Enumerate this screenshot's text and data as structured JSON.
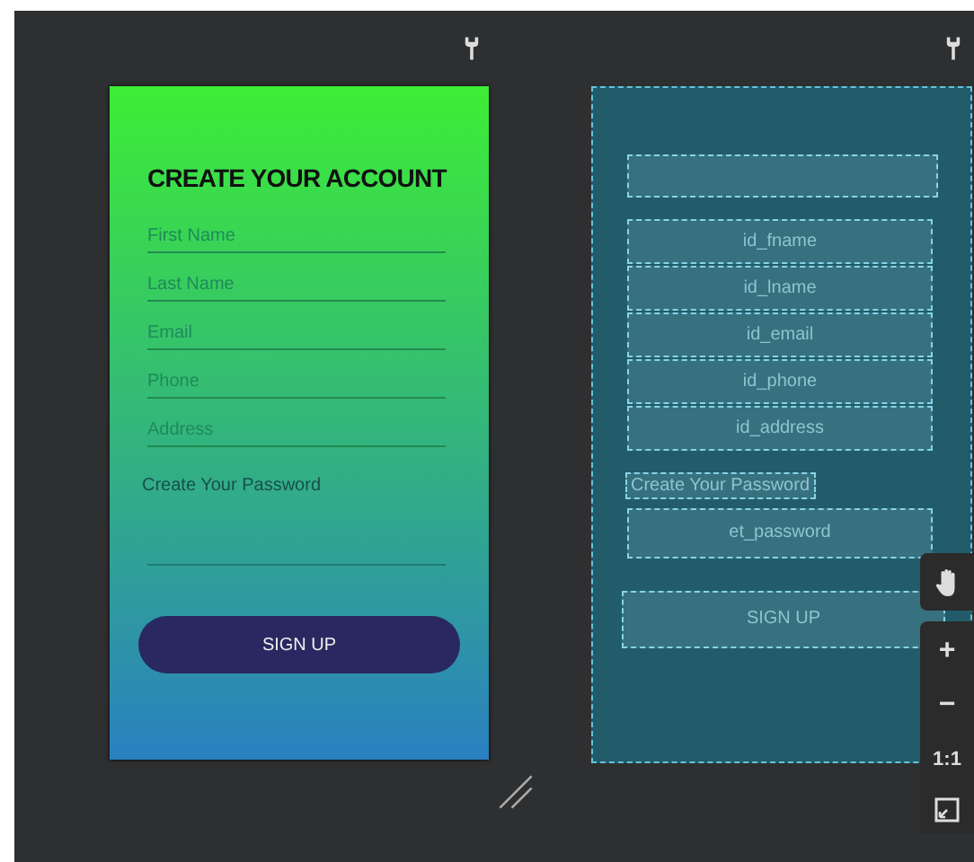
{
  "design": {
    "title": "CREATE YOUR ACCOUNT",
    "fields": [
      {
        "placeholder": "First Name"
      },
      {
        "placeholder": "Last Name"
      },
      {
        "placeholder": "Email"
      },
      {
        "placeholder": "Phone"
      },
      {
        "placeholder": "Address"
      }
    ],
    "password_label": "Create Your Password",
    "button": "SIGN UP"
  },
  "blueprint": {
    "views": [
      {
        "kind": "title"
      },
      {
        "kind": "box",
        "label": "id_fname"
      },
      {
        "kind": "box",
        "label": "id_lname"
      },
      {
        "kind": "box",
        "label": "id_email"
      },
      {
        "kind": "box",
        "label": "id_phone"
      },
      {
        "kind": "box",
        "label": "id_address"
      },
      {
        "kind": "text",
        "label": "Create Your Password"
      },
      {
        "kind": "field",
        "label": "et_password"
      },
      {
        "kind": "button",
        "label": "SIGN UP"
      }
    ]
  },
  "zoom_controls": [
    "+",
    "−",
    "1:1"
  ]
}
